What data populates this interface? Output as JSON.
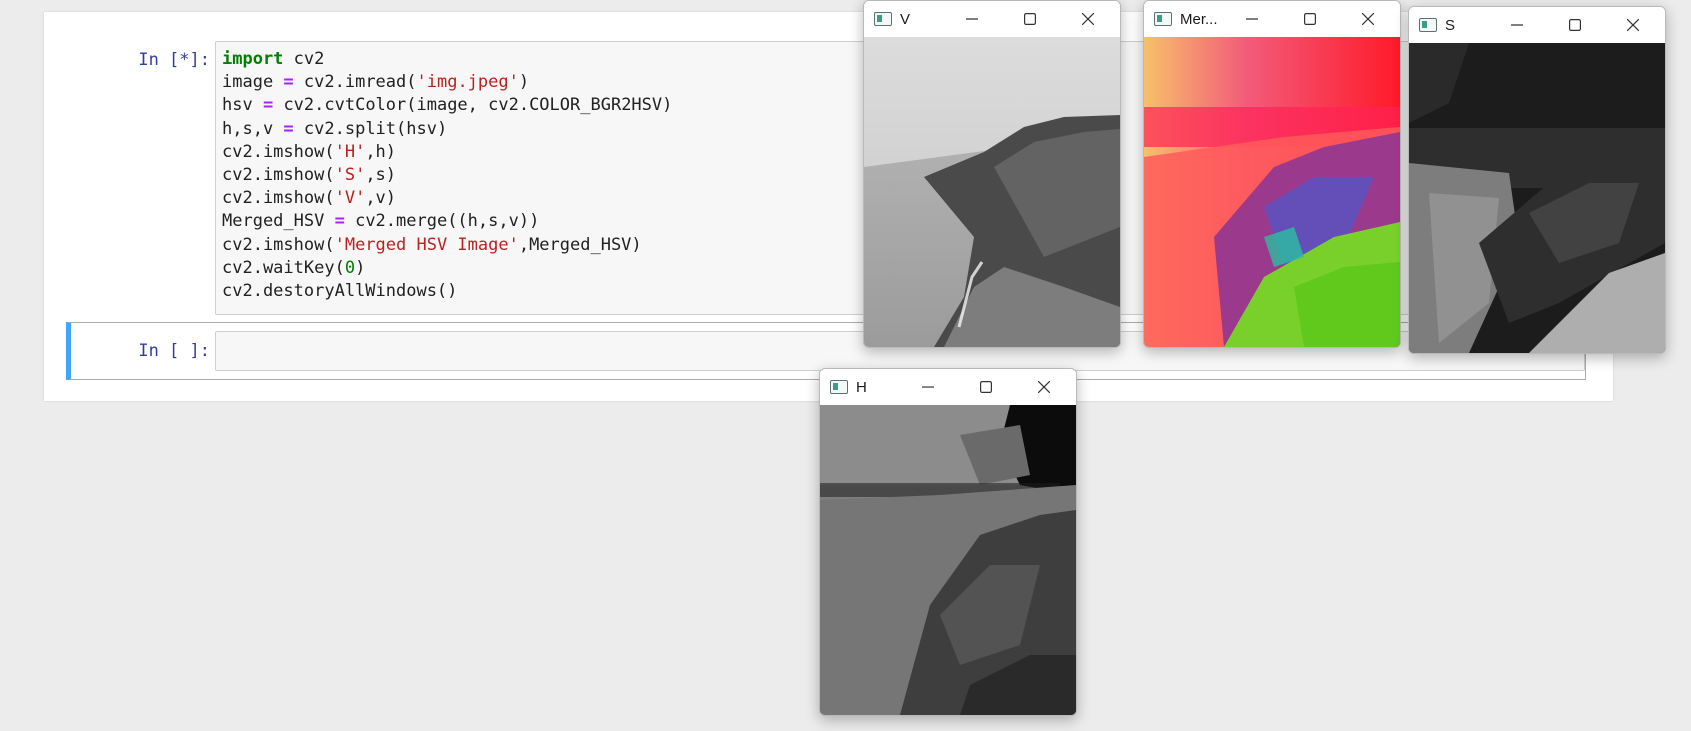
{
  "notebook": {
    "cell1_prompt": "In [*]:",
    "cell2_prompt": "In [ ]:",
    "code_lines": [
      [
        {
          "t": "import",
          "c": "kw"
        },
        {
          "t": " cv2",
          "c": ""
        }
      ],
      [
        {
          "t": "image ",
          "c": ""
        },
        {
          "t": "=",
          "c": "op"
        },
        {
          "t": " cv2.imread(",
          "c": ""
        },
        {
          "t": "'img.jpeg'",
          "c": "str"
        },
        {
          "t": ")",
          "c": ""
        }
      ],
      [
        {
          "t": "hsv ",
          "c": ""
        },
        {
          "t": "=",
          "c": "op"
        },
        {
          "t": " cv2.cvtColor(image, cv2.COLOR_BGR2HSV)",
          "c": ""
        }
      ],
      [
        {
          "t": "h,s,v ",
          "c": ""
        },
        {
          "t": "=",
          "c": "op"
        },
        {
          "t": " cv2.split(hsv)",
          "c": ""
        }
      ],
      [
        {
          "t": "cv2.imshow(",
          "c": ""
        },
        {
          "t": "'H'",
          "c": "str"
        },
        {
          "t": ",h)",
          "c": ""
        }
      ],
      [
        {
          "t": "cv2.imshow(",
          "c": ""
        },
        {
          "t": "'S'",
          "c": "str"
        },
        {
          "t": ",s)",
          "c": ""
        }
      ],
      [
        {
          "t": "cv2.imshow(",
          "c": ""
        },
        {
          "t": "'V'",
          "c": "str"
        },
        {
          "t": ",v)",
          "c": ""
        }
      ],
      [
        {
          "t": "Merged_HSV ",
          "c": ""
        },
        {
          "t": "=",
          "c": "op"
        },
        {
          "t": " cv2.merge((h,s,v))",
          "c": ""
        }
      ],
      [
        {
          "t": "cv2.imshow(",
          "c": ""
        },
        {
          "t": "'Merged HSV Image'",
          "c": "str"
        },
        {
          "t": ",Merged_HSV)",
          "c": ""
        }
      ],
      [
        {
          "t": "cv2.waitKey(",
          "c": ""
        },
        {
          "t": "0",
          "c": "num"
        },
        {
          "t": ")",
          "c": ""
        }
      ],
      [
        {
          "t": "cv2.destoryAllWindows()",
          "c": ""
        }
      ]
    ]
  },
  "windows": {
    "v": {
      "title": "V"
    },
    "merged": {
      "title": "Mer..."
    },
    "s": {
      "title": "S"
    },
    "h": {
      "title": "H"
    }
  },
  "icons": {
    "app": "opencv-window-icon",
    "minimize": "minimize-icon",
    "maximize": "maximize-icon",
    "close": "close-icon"
  }
}
